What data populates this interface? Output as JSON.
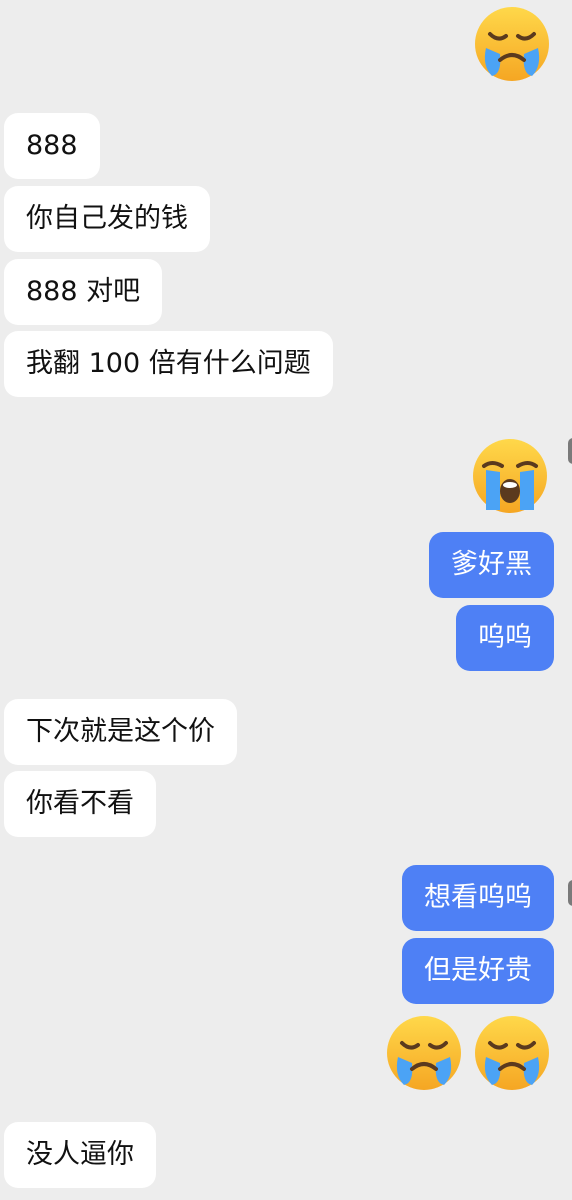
{
  "messages": {
    "in_1": "888",
    "in_2": "你自己发的钱",
    "in_3": "888 对吧",
    "in_4": "我翻 100 倍有什么问题",
    "out_1": "爹好黑",
    "out_2": "呜呜",
    "in_5": "下次就是这个价",
    "in_6": "你看不看",
    "out_3": "想看呜呜",
    "out_4": "但是好贵",
    "in_7": "没人逼你"
  },
  "emojis": {
    "top": "crying-face-icon",
    "mid": "loudly-crying-face-icon",
    "bottom_1": "crying-face-icon",
    "bottom_2": "crying-face-icon"
  },
  "colors": {
    "background": "#EDEDED",
    "incoming_bubble": "#FFFFFF",
    "outgoing_bubble": "#4E80F5",
    "incoming_text": "#111111",
    "outgoing_text": "#FFFFFF"
  }
}
